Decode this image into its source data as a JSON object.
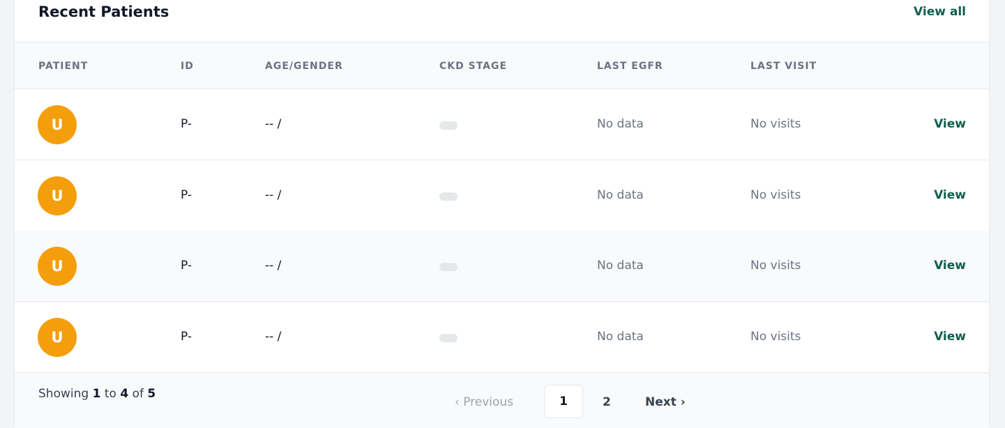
{
  "header": {
    "title": "Recent Patients",
    "view_all": "View all"
  },
  "table": {
    "columns": [
      "PATIENT",
      "ID",
      "AGE/GENDER",
      "CKD STAGE",
      "LAST EGFR",
      "LAST VISIT"
    ],
    "rows": [
      {
        "initial": "U",
        "id": "P-",
        "age_gender": "-- /",
        "ckd_stage": "",
        "last_egfr": "No data",
        "last_visit": "No visits",
        "action": "View"
      },
      {
        "initial": "U",
        "id": "P-",
        "age_gender": "-- /",
        "ckd_stage": "",
        "last_egfr": "No data",
        "last_visit": "No visits",
        "action": "View"
      },
      {
        "initial": "U",
        "id": "P-",
        "age_gender": "-- /",
        "ckd_stage": "",
        "last_egfr": "No data",
        "last_visit": "No visits",
        "action": "View"
      },
      {
        "initial": "U",
        "id": "P-",
        "age_gender": "-- /",
        "ckd_stage": "",
        "last_egfr": "No data",
        "last_visit": "No visits",
        "action": "View"
      }
    ]
  },
  "pagination": {
    "showing_prefix": "Showing",
    "from": "1",
    "to_word": "to",
    "to": "4",
    "of_word": "of",
    "total": "5",
    "prev_label": "‹ Previous",
    "pages": [
      "1",
      "2"
    ],
    "next_label": "Next ›"
  },
  "colors": {
    "accent": "#115e4f",
    "avatar_bg": "#f59e0b",
    "muted_text": "#6b7280",
    "header_bg": "#f9fafb"
  }
}
